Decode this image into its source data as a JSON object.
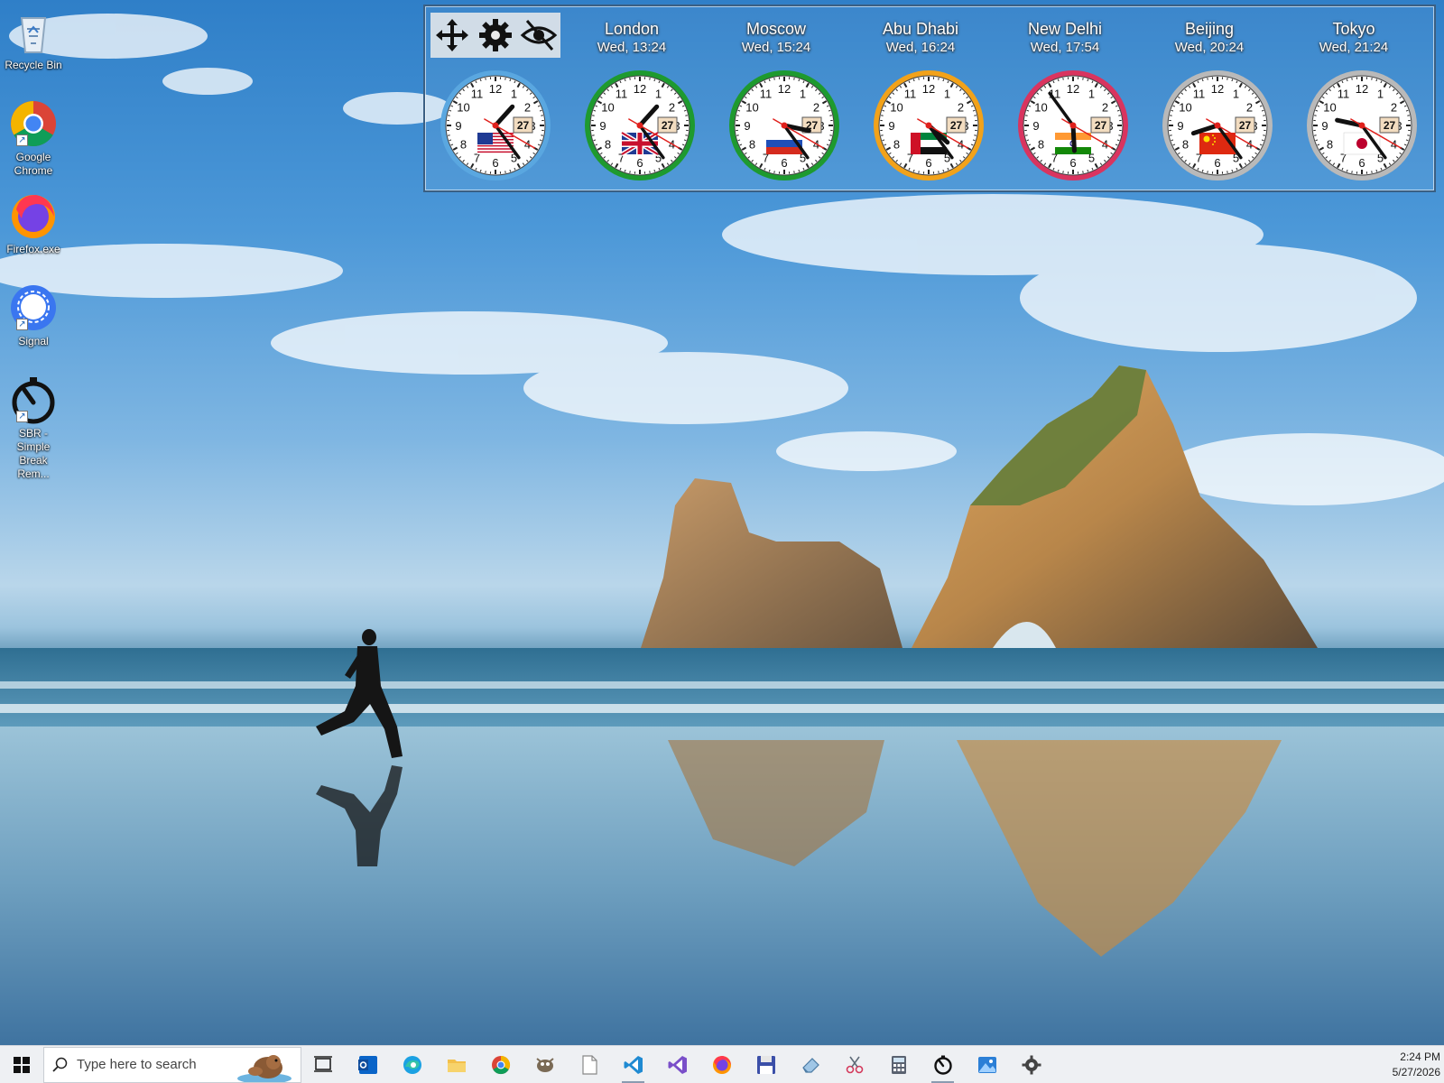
{
  "desktop_icons": [
    {
      "name": "recycle-bin",
      "label": "Recycle Bin",
      "icon": "recycle-bin-icon",
      "shortcut": false
    },
    {
      "name": "google-chrome",
      "label": "Google Chrome",
      "icon": "chrome-icon",
      "shortcut": true
    },
    {
      "name": "firefox",
      "label": "Firefox.exe",
      "icon": "firefox-icon",
      "shortcut": false
    },
    {
      "name": "signal",
      "label": "Signal",
      "icon": "signal-icon",
      "shortcut": true
    },
    {
      "name": "sbr",
      "label": "SBR - Simple Break Rem...",
      "icon": "stopwatch-icon",
      "shortcut": true
    }
  ],
  "clock_widget": {
    "toolbar": {
      "move": "move-icon",
      "settings": "gear-icon",
      "hide": "eye-slash-icon"
    },
    "clocks": [
      {
        "city": "London",
        "time": "Wed, 13:24",
        "day": "27",
        "ring": "#5aa7e0",
        "flag": "us-flag",
        "hour": 1,
        "minute": 24,
        "second": 20
      },
      {
        "city": "Moscow",
        "time": "Wed, 15:24",
        "day": "27",
        "ring": "#1e9a2f",
        "flag": "uk-flag",
        "hour": 1,
        "minute": 24,
        "second": 20
      },
      {
        "city": "Abu Dhabi",
        "time": "Wed, 16:24",
        "day": "27",
        "ring": "#1e9a2f",
        "flag": "russia-flag",
        "hour": 3,
        "minute": 24,
        "second": 20
      },
      {
        "city": "New Delhi",
        "time": "Wed, 17:54",
        "day": "27",
        "ring": "#f2a21a",
        "flag": "uae-flag",
        "hour": 4,
        "minute": 24,
        "second": 20
      },
      {
        "city": "Beijing",
        "time": "Wed, 20:24",
        "day": "27",
        "ring": "#d9345f",
        "flag": "india-flag",
        "hour": 5,
        "minute": 54,
        "second": 20
      },
      {
        "city": "Tokyo",
        "time": "Wed, 21:24",
        "day": "27",
        "ring": "#b9b9b9",
        "flag": "china-flag",
        "hour": 8,
        "minute": 24,
        "second": 20
      }
    ],
    "extra_clock": {
      "day": "27",
      "ring": "#b9b9b9",
      "flag": "japan-flag",
      "hour": 9,
      "minute": 24,
      "second": 20
    }
  },
  "taskbar": {
    "search_placeholder": "Type here to search",
    "apps": [
      {
        "name": "task-view",
        "icon": "task-view-icon",
        "running": false
      },
      {
        "name": "outlook",
        "icon": "outlook-icon",
        "running": false
      },
      {
        "name": "edge",
        "icon": "edge-icon",
        "running": false
      },
      {
        "name": "file-explorer",
        "icon": "folder-icon",
        "running": false
      },
      {
        "name": "chrome",
        "icon": "chrome-icon",
        "running": false
      },
      {
        "name": "gimp",
        "icon": "gimp-icon",
        "running": false
      },
      {
        "name": "notepad",
        "icon": "blank-document-icon",
        "running": false
      },
      {
        "name": "vscode",
        "icon": "vscode-icon",
        "running": true
      },
      {
        "name": "visual-studio",
        "icon": "visual-studio-icon",
        "running": false
      },
      {
        "name": "firefox",
        "icon": "firefox-icon",
        "running": false
      },
      {
        "name": "save-tool",
        "icon": "floppy-disk-icon",
        "running": false
      },
      {
        "name": "eraser-tool",
        "icon": "eraser-icon",
        "running": false
      },
      {
        "name": "snipping-tool",
        "icon": "snip-icon",
        "running": false
      },
      {
        "name": "calculator",
        "icon": "calculator-icon",
        "running": false
      },
      {
        "name": "sbr-timer",
        "icon": "stopwatch-icon",
        "running": true
      },
      {
        "name": "photos",
        "icon": "photos-icon",
        "running": false
      },
      {
        "name": "settings",
        "icon": "gear-icon",
        "running": false
      }
    ],
    "clock_time": "2:24 PM",
    "clock_date": "5/27/2026"
  }
}
